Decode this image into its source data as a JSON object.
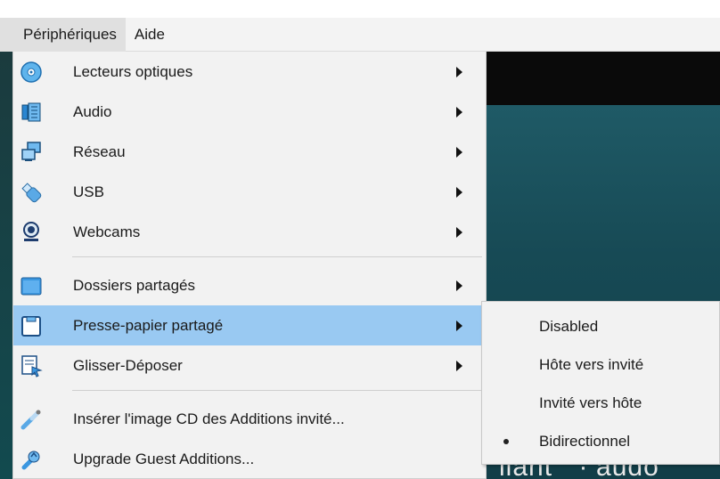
{
  "menubar": {
    "items": [
      {
        "label": "Périphériques",
        "active": true
      },
      {
        "label": "Aide",
        "active": false
      }
    ]
  },
  "menu": {
    "items": [
      {
        "label": "Lecteurs optiques",
        "icon": "optical-disc-icon",
        "submenu": true
      },
      {
        "label": "Audio",
        "icon": "audio-icon",
        "submenu": true
      },
      {
        "label": "Réseau",
        "icon": "network-icon",
        "submenu": true
      },
      {
        "label": "USB",
        "icon": "usb-icon",
        "submenu": true
      },
      {
        "label": "Webcams",
        "icon": "webcam-icon",
        "submenu": true
      },
      {
        "label": "Dossiers partagés",
        "icon": "shared-folder-icon",
        "submenu": true
      },
      {
        "label": "Presse-papier partagé",
        "icon": "clipboard-icon",
        "submenu": true,
        "highlighted": true
      },
      {
        "label": "Glisser-Déposer",
        "icon": "drag-drop-icon",
        "submenu": true
      },
      {
        "label": "Insérer l'image CD des Additions invité...",
        "icon": "guest-additions-cd-icon",
        "submenu": false
      },
      {
        "label": "Upgrade Guest Additions...",
        "icon": "upgrade-guest-additions-icon",
        "submenu": false
      }
    ]
  },
  "submenu": {
    "items": [
      {
        "label": "Disabled",
        "selected": false
      },
      {
        "label": "Hôte vers invité",
        "selected": false
      },
      {
        "label": "Invité vers hôte",
        "selected": false
      },
      {
        "label": "Bidirectionnel",
        "selected": true
      }
    ]
  },
  "vm": {
    "partial_text": "liant \" ∙ audo"
  },
  "colors": {
    "highlight": "#99c9f2",
    "menu_bg": "#f2f2f2",
    "menubar_bg": "#f3f3f3",
    "vm_teal": "#174a55"
  }
}
